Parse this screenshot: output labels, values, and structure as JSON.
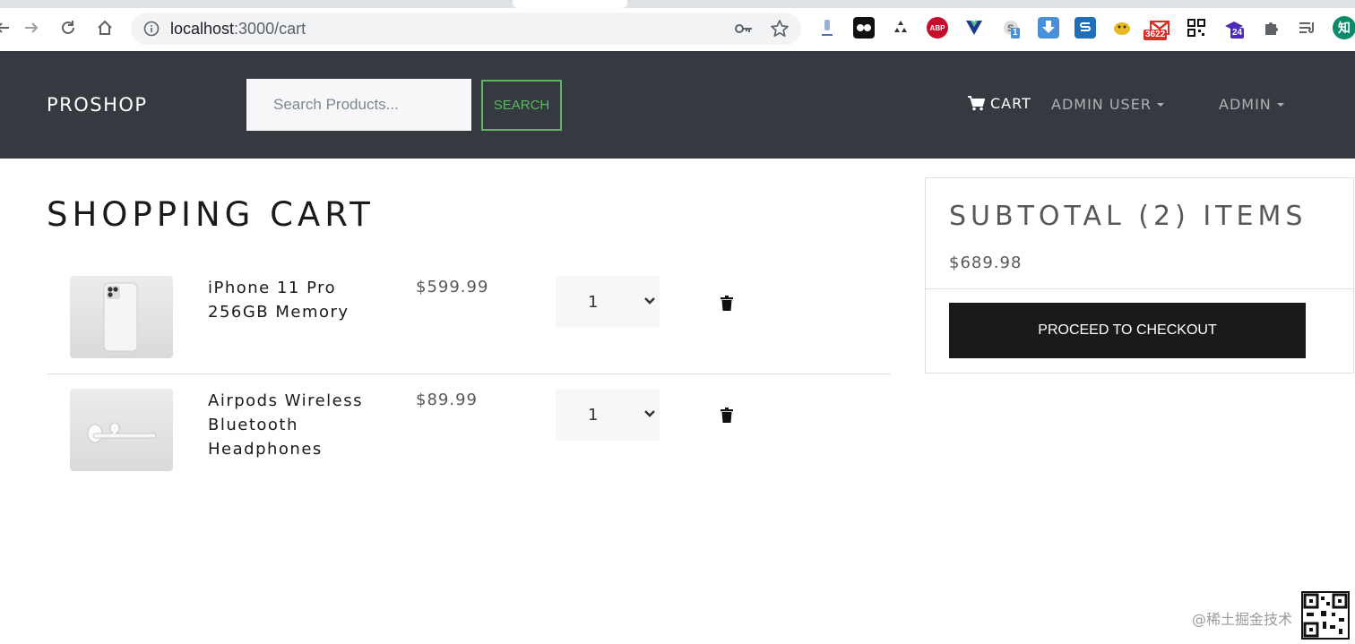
{
  "browser": {
    "url_host": "localhost",
    "url_path": ":3000/cart",
    "extensions": [
      {
        "name": "pin-extension-icon"
      },
      {
        "name": "tampermonkey-extension-icon"
      },
      {
        "name": "recycle-extension-icon"
      },
      {
        "name": "adblock-plus-extension-icon",
        "label": "ABP",
        "color": "#c70d2c"
      },
      {
        "name": "vue-devtools-extension-icon"
      },
      {
        "name": "s-extension-icon",
        "badge": "1"
      },
      {
        "name": "download-extension-icon"
      },
      {
        "name": "sizzy-extension-icon"
      },
      {
        "name": "tapermonkey-extension-icon"
      },
      {
        "name": "gmail-extension-icon",
        "badge": "3622"
      },
      {
        "name": "qr-code-extension-icon"
      },
      {
        "name": "academic-extension-icon",
        "badge": "24"
      },
      {
        "name": "puzzle-extension-icon"
      },
      {
        "name": "reading-list-icon"
      },
      {
        "name": "zhihu-extension-icon",
        "label": "知"
      }
    ]
  },
  "navbar": {
    "brand": "PROSHOP",
    "search_placeholder": "Search Products...",
    "search_button": "SEARCH",
    "cart_label": "CART",
    "user_menu": "ADMIN USER",
    "admin_menu": "ADMIN"
  },
  "cart": {
    "title": "SHOPPING CART",
    "items": [
      {
        "name": "iPhone 11 Pro 256GB Memory",
        "price": "$599.99",
        "qty": "1"
      },
      {
        "name": "Airpods Wireless Bluetooth Headphones",
        "price": "$89.99",
        "qty": "1"
      }
    ]
  },
  "summary": {
    "title": "SUBTOTAL (2) ITEMS",
    "total": "$689.98",
    "checkout_button": "PROCEED TO CHECKOUT"
  },
  "watermark": {
    "text": "@稀土掘金技术"
  },
  "colors": {
    "navbar_bg": "#343a40",
    "accent_green": "#5cb85c",
    "checkout_bg": "#1a1a1a"
  }
}
